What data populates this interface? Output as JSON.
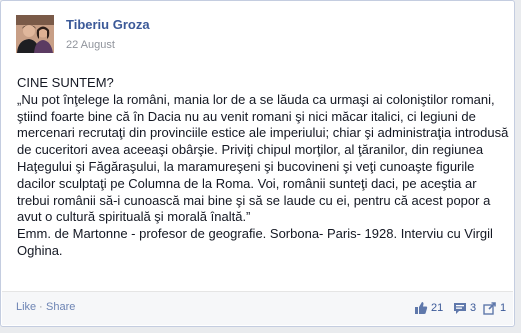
{
  "post": {
    "author": "Tiberiu Groza",
    "date": "22 August",
    "heading": "CINE SUNTEM?",
    "quote": "„Nu pot înţelege la români, mania lor de a se lăuda ca urmaşi ai coloniştilor romani, ştiind foarte bine că în Dacia nu au venit romani şi nici măcar italici, ci legiuni de mercenari recrutaţi din provinciile estice ale imperiului; chiar şi administraţia introdusă de cuceritori avea aceeaşi obârşie. Priviţi chipul morţilor, al ţăranilor, din regiunea Haţegului şi Făgăraşului, la maramureşeni şi bucovineni şi veţi cunoaşte figurile dacilor sculptaţi pe Columna de la Roma. Voi, românii sunteţi daci, pe aceştia ar trebui românii să-i cunoască mai bine şi să se laude cu ei, pentru că acest popor a avut o cultură spirituală şi morală înaltă.”",
    "attribution": "Emm. de Martonne - profesor de geografie. Sorbona- Paris- 1928. Interviu cu Virgil Oghina."
  },
  "footer": {
    "like_label": "Like",
    "separator": "·",
    "share_label": "Share",
    "likes_count": "21",
    "comments_count": "3",
    "shares_count": "1"
  },
  "icons": {
    "like": "thumbs-up-icon",
    "comment": "comment-icon",
    "share": "share-icon"
  },
  "colors": {
    "link": "#3b5998",
    "footer_link": "#6d84b4",
    "text": "#141823",
    "muted": "#90949c"
  }
}
